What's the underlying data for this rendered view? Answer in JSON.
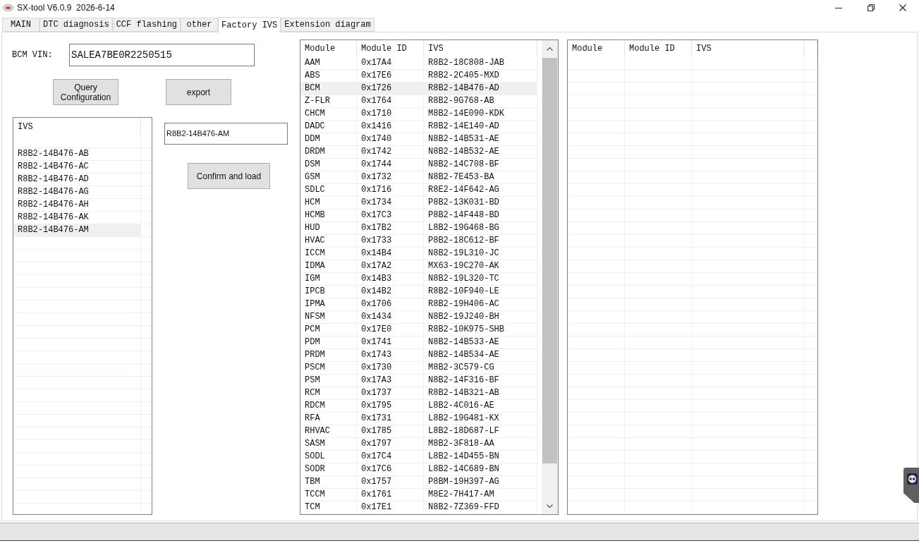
{
  "window": {
    "title": "SX-tool V6.0.9  2026-6-14"
  },
  "tabs": [
    {
      "label": "MAIN",
      "selected": false
    },
    {
      "label": "DTC diagnosis",
      "selected": false
    },
    {
      "label": "CCF flashing",
      "selected": false
    },
    {
      "label": "other",
      "selected": false
    },
    {
      "label": "Factory IVS",
      "selected": true
    },
    {
      "label": "Extension diagram",
      "selected": false
    }
  ],
  "vin": {
    "label": "BCM VIN:",
    "value": "SALEA7BE0R2250515"
  },
  "buttons": [
    "Query Configuration",
    "export"
  ],
  "ivs_list": {
    "column": "IVS",
    "items": [
      {
        "text": "R8B2-14B476-AB",
        "selected": false
      },
      {
        "text": "R8B2-14B476-AC",
        "selected": false
      },
      {
        "text": "R8B2-14B476-AD",
        "selected": false
      },
      {
        "text": "R8B2-14B476-AG",
        "selected": false
      },
      {
        "text": "R8B2-14B476-AH",
        "selected": false
      },
      {
        "text": "R8B2-14B476-AK",
        "selected": false
      },
      {
        "text": "R8B2-14B476-AM",
        "selected": true
      }
    ]
  },
  "ivs_field": {
    "value": "R8B2-14B476-AM"
  },
  "confirm_button": "Confirm and load",
  "modules_table": {
    "columns": [
      "Module",
      "Module ID",
      "IVS"
    ],
    "rows": [
      {
        "module": "AAM",
        "module_id": "0x17A4",
        "ivs": "R8B2-18C808-JAB",
        "selected": false
      },
      {
        "module": "ABS",
        "module_id": "0x17E6",
        "ivs": "R8B2-2C405-MXD",
        "selected": false
      },
      {
        "module": "BCM",
        "module_id": "0x1726",
        "ivs": "R8B2-14B476-AD",
        "selected": true
      },
      {
        "module": "Z-FLR",
        "module_id": "0x1764",
        "ivs": "R8B2-9G768-AB",
        "selected": false
      },
      {
        "module": "CHCM",
        "module_id": "0x1710",
        "ivs": "M8B2-14E090-KDK",
        "selected": false
      },
      {
        "module": "DADC",
        "module_id": "0x1416",
        "ivs": "R8B2-14E140-AD",
        "selected": false
      },
      {
        "module": "DDM",
        "module_id": "0x1740",
        "ivs": "N8B2-14B531-AE",
        "selected": false
      },
      {
        "module": "DRDM",
        "module_id": "0x1742",
        "ivs": "N8B2-14B532-AE",
        "selected": false
      },
      {
        "module": "DSM",
        "module_id": "0x1744",
        "ivs": "N8B2-14C708-BF",
        "selected": false
      },
      {
        "module": "GSM",
        "module_id": "0x1732",
        "ivs": "N8B2-7E453-BA",
        "selected": false
      },
      {
        "module": "SDLC",
        "module_id": "0x1716",
        "ivs": "R8E2-14F642-AG",
        "selected": false
      },
      {
        "module": "HCM",
        "module_id": "0x1734",
        "ivs": "P8B2-13K031-BD",
        "selected": false
      },
      {
        "module": "HCMB",
        "module_id": "0x17C3",
        "ivs": "P8B2-14F448-BD",
        "selected": false
      },
      {
        "module": "HUD",
        "module_id": "0x17B2",
        "ivs": "L8B2-19G468-BG",
        "selected": false
      },
      {
        "module": "HVAC",
        "module_id": "0x1733",
        "ivs": "P8B2-18C612-BF",
        "selected": false
      },
      {
        "module": "ICCM",
        "module_id": "0x14B4",
        "ivs": "N8B2-19L310-JC",
        "selected": false
      },
      {
        "module": "IDMA",
        "module_id": "0x17A2",
        "ivs": "MX63-19C270-AK",
        "selected": false
      },
      {
        "module": "IGM",
        "module_id": "0x14B3",
        "ivs": "N8B2-19L320-TC",
        "selected": false
      },
      {
        "module": "IPCB",
        "module_id": "0x14B2",
        "ivs": "R8B2-10F940-LE",
        "selected": false
      },
      {
        "module": "IPMA",
        "module_id": "0x1706",
        "ivs": "R8B2-19H406-AC",
        "selected": false
      },
      {
        "module": "NFSM",
        "module_id": "0x1434",
        "ivs": "N8B2-19J240-BH",
        "selected": false
      },
      {
        "module": "PCM",
        "module_id": "0x17E0",
        "ivs": "R8B2-10K975-SHB",
        "selected": false
      },
      {
        "module": "PDM",
        "module_id": "0x1741",
        "ivs": "N8B2-14B533-AE",
        "selected": false
      },
      {
        "module": "PRDM",
        "module_id": "0x1743",
        "ivs": "N8B2-14B534-AE",
        "selected": false
      },
      {
        "module": "PSCM",
        "module_id": "0x1730",
        "ivs": "M8B2-3C579-CG",
        "selected": false
      },
      {
        "module": "PSM",
        "module_id": "0x17A3",
        "ivs": "N8B2-14F316-BF",
        "selected": false
      },
      {
        "module": "RCM",
        "module_id": "0x1737",
        "ivs": "R8B2-14B321-AB",
        "selected": false
      },
      {
        "module": "RDCM",
        "module_id": "0x1795",
        "ivs": "L8B2-4C016-AE",
        "selected": false
      },
      {
        "module": "RFA",
        "module_id": "0x1731",
        "ivs": "L8B2-19G481-KX",
        "selected": false
      },
      {
        "module": "RHVAC",
        "module_id": "0x1785",
        "ivs": "L8B2-18D687-LF",
        "selected": false
      },
      {
        "module": "SASM",
        "module_id": "0x1797",
        "ivs": "M8B2-3F818-AA",
        "selected": false
      },
      {
        "module": "SODL",
        "module_id": "0x17C4",
        "ivs": "L8B2-14D455-BN",
        "selected": false
      },
      {
        "module": "SODR",
        "module_id": "0x17C6",
        "ivs": "L8B2-14C689-BN",
        "selected": false
      },
      {
        "module": "TBM",
        "module_id": "0x1757",
        "ivs": "P8BM-19H397-AG",
        "selected": false
      },
      {
        "module": "TCCM",
        "module_id": "0x1761",
        "ivs": "M8E2-7H417-AM",
        "selected": false
      },
      {
        "module": "TCM",
        "module_id": "0x17E1",
        "ivs": "N8B2-7Z369-FFD",
        "selected": false
      }
    ]
  },
  "result_table": {
    "columns": [
      "Module",
      "Module ID",
      "IVS"
    ]
  }
}
